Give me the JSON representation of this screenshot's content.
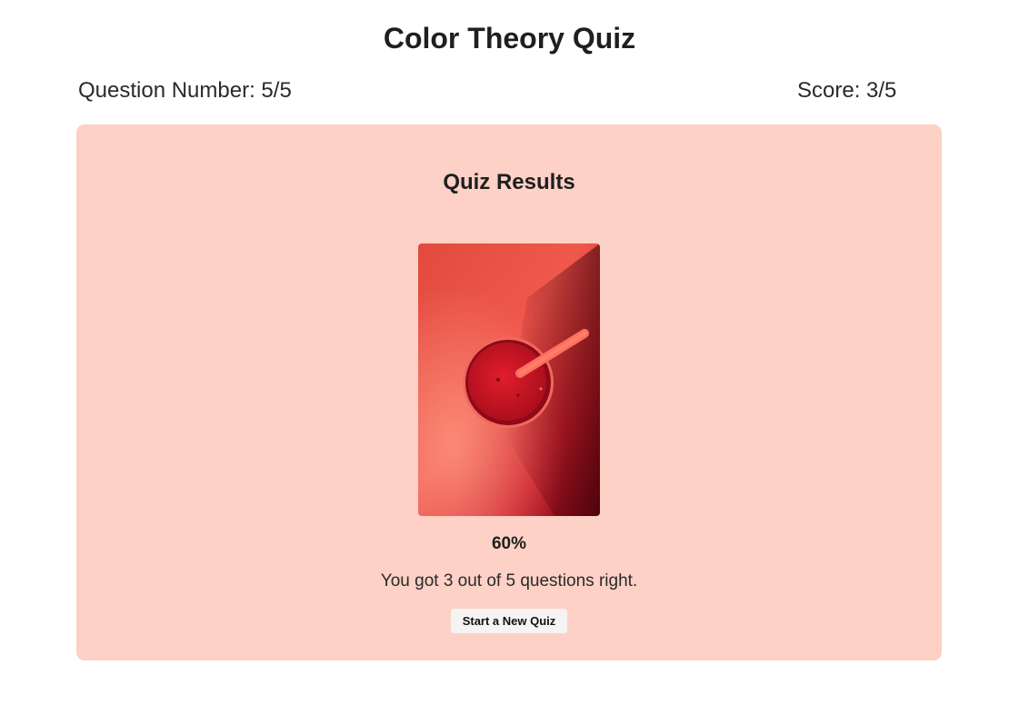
{
  "header": {
    "title": "Color Theory Quiz",
    "question_number": "Question Number: 5/5",
    "score": "Score: 3/5"
  },
  "results": {
    "heading": "Quiz Results",
    "image_icon": "red-smoothie-cup-photo",
    "percentage": "60%",
    "percentage_value": 0.6,
    "summary": "You got 3 out of 5 questions right.",
    "new_quiz_label": "Start a New Quiz"
  },
  "colors": {
    "card_background": "#fdd1c6",
    "accent_red": "#d9232f",
    "button_background": "#f6f4f3"
  }
}
